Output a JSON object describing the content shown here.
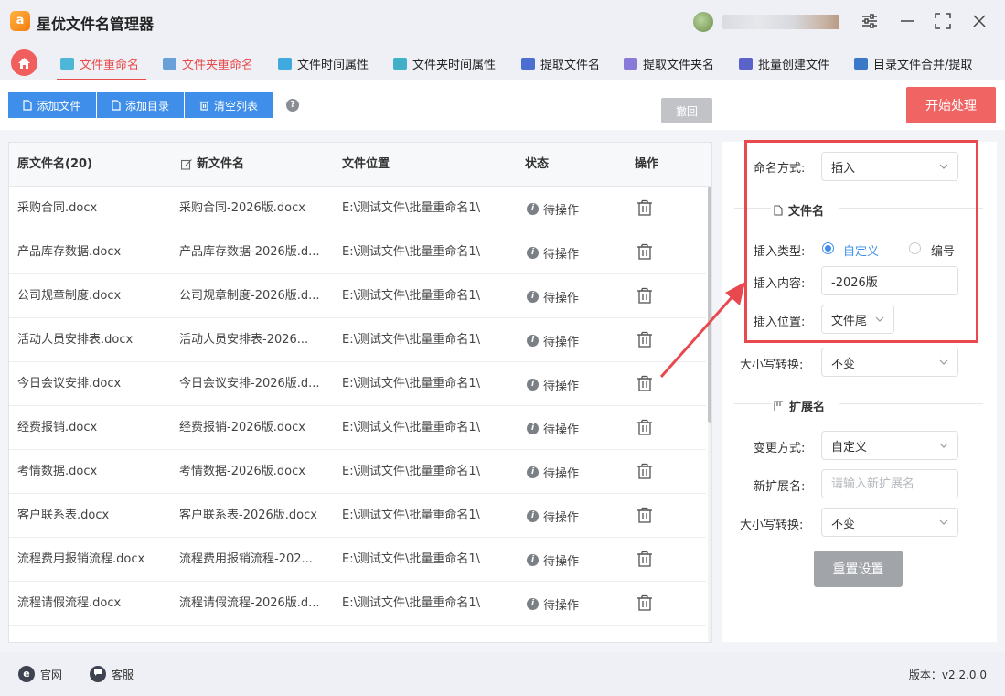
{
  "app": {
    "logo_glyph": "a",
    "title": "星优文件名管理器"
  },
  "tabs": [
    {
      "label": "文件重命名",
      "icon": "rename-file-icon",
      "color": "#4fb6d8"
    },
    {
      "label": "文件夹重命名",
      "icon": "rename-folder-icon",
      "color": "#6aa0d8"
    },
    {
      "label": "文件时间属性",
      "icon": "file-time-icon",
      "color": "#3fa9e0"
    },
    {
      "label": "文件夹时间属性",
      "icon": "folder-time-icon",
      "color": "#3fb0c8"
    },
    {
      "label": "提取文件名",
      "icon": "extract-filename-icon",
      "color": "#4a6fd0"
    },
    {
      "label": "提取文件夹名",
      "icon": "extract-foldername-icon",
      "color": "#8a7ad8"
    },
    {
      "label": "批量创建文件",
      "icon": "batch-create-icon",
      "color": "#5a64c8"
    },
    {
      "label": "目录文件合并/提取",
      "icon": "merge-extract-icon",
      "color": "#3a78c8"
    }
  ],
  "toolbar": {
    "add_file": "添加文件",
    "add_dir": "添加目录",
    "clear_list": "清空列表",
    "help": "?",
    "undo": "撤回",
    "start": "开始处理"
  },
  "table": {
    "headers": {
      "original": "原文件名(20)",
      "new": "新文件名",
      "location": "文件位置",
      "status": "状态",
      "action": "操作"
    },
    "rows": [
      {
        "original": "采购合同.docx",
        "new": "采购合同-2026版.docx",
        "location": "E:\\测试文件\\批量重命名1\\",
        "status": "待操作"
      },
      {
        "original": "产品库存数据.docx",
        "new": "产品库存数据-2026版.d...",
        "location": "E:\\测试文件\\批量重命名1\\",
        "status": "待操作"
      },
      {
        "original": "公司规章制度.docx",
        "new": "公司规章制度-2026版.d...",
        "location": "E:\\测试文件\\批量重命名1\\",
        "status": "待操作"
      },
      {
        "original": "活动人员安排表.docx",
        "new": "活动人员安排表-2026...",
        "location": "E:\\测试文件\\批量重命名1\\",
        "status": "待操作"
      },
      {
        "original": "今日会议安排.docx",
        "new": "今日会议安排-2026版.d...",
        "location": "E:\\测试文件\\批量重命名1\\",
        "status": "待操作"
      },
      {
        "original": "经费报销.docx",
        "new": "经费报销-2026版.docx",
        "location": "E:\\测试文件\\批量重命名1\\",
        "status": "待操作"
      },
      {
        "original": "考情数据.docx",
        "new": "考情数据-2026版.docx",
        "location": "E:\\测试文件\\批量重命名1\\",
        "status": "待操作"
      },
      {
        "original": "客户联系表.docx",
        "new": "客户联系表-2026版.docx",
        "location": "E:\\测试文件\\批量重命名1\\",
        "status": "待操作"
      },
      {
        "original": "流程费用报销流程.docx",
        "new": "流程费用报销流程-202...",
        "location": "E:\\测试文件\\批量重命名1\\",
        "status": "待操作"
      },
      {
        "original": "流程请假流程.docx",
        "new": "流程请假流程-2026版.d...",
        "location": "E:\\测试文件\\批量重命名1\\",
        "status": "待操作"
      }
    ]
  },
  "panel": {
    "naming_mode_label": "命名方式:",
    "naming_mode_value": "插入",
    "filename_section": "文件名",
    "insert_type_label": "插入类型:",
    "insert_type_custom": "自定义",
    "insert_type_number": "编号",
    "insert_content_label": "插入内容:",
    "insert_content_value": "-2026版",
    "insert_position_label": "插入位置:",
    "insert_position_value": "文件尾",
    "case_label": "大小写转换:",
    "case_value": "不变",
    "ext_section": "扩展名",
    "change_mode_label": "变更方式:",
    "change_mode_value": "自定义",
    "new_ext_label": "新扩展名:",
    "new_ext_placeholder": "请输入新扩展名",
    "ext_case_label": "大小写转换:",
    "ext_case_value": "不变",
    "reset": "重置设置"
  },
  "footer": {
    "website": "官网",
    "website_glyph": "e",
    "support": "客服",
    "version": "版本：v2.2.0.0"
  },
  "colors": {
    "accent_red": "#e94b4b",
    "primary_blue": "#3f8fea",
    "highlight": "#e8494f"
  }
}
